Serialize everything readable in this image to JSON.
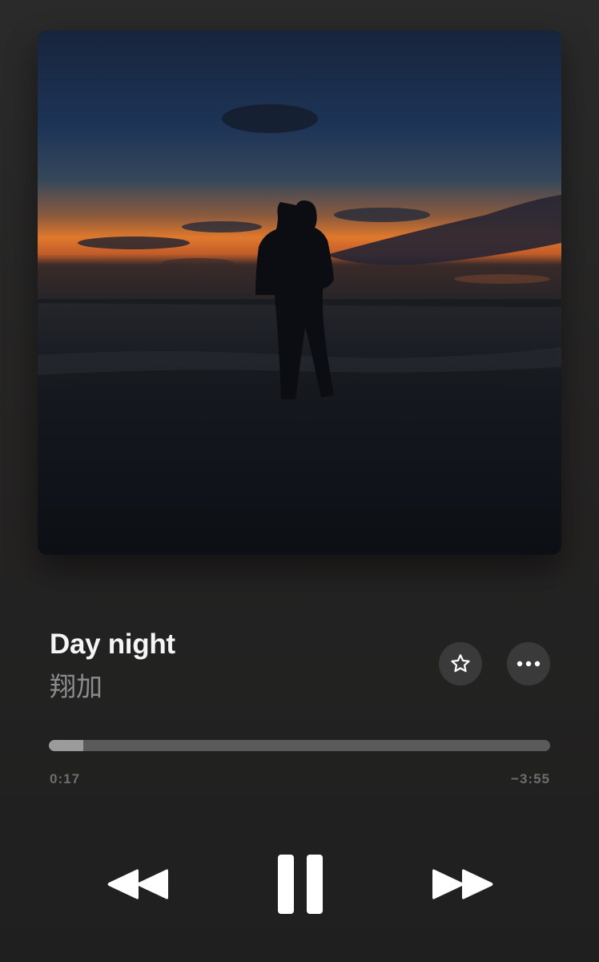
{
  "track": {
    "title": "Day night",
    "artist": "翔加"
  },
  "progress": {
    "elapsed": "0:17",
    "remaining": "−3:55",
    "fraction": 0.068
  },
  "controls": {
    "favorite_icon": "star-icon",
    "more_icon": "ellipsis-icon",
    "rewind_icon": "rewind-icon",
    "pause_icon": "pause-icon",
    "forward_icon": "fast-forward-icon"
  },
  "colors": {
    "background": "#252423",
    "progress_track": "#5a5a5a",
    "progress_fill": "#9b9b9b",
    "secondary_text": "#8c8c8c"
  }
}
